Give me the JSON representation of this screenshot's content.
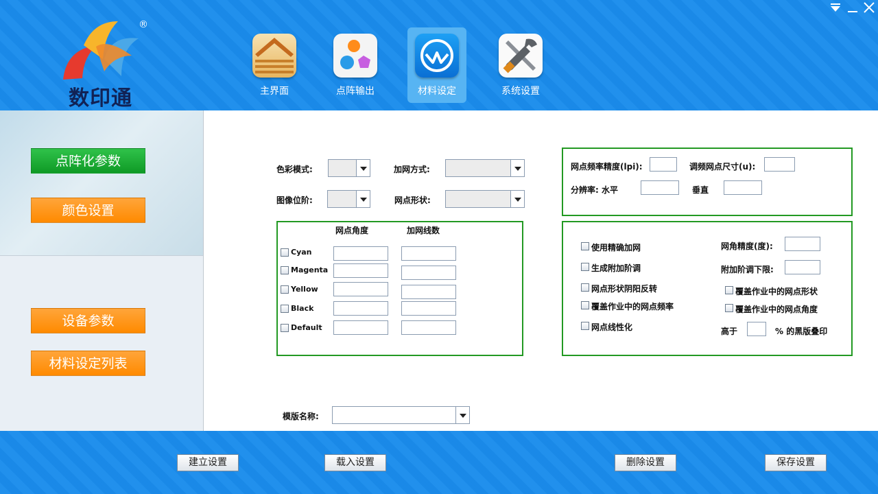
{
  "app": {
    "brand": "数印通",
    "reg_mark": "®"
  },
  "window_controls": {
    "menu": "⏷",
    "minimize": "—",
    "close": "✕"
  },
  "nav": [
    {
      "label": "主界面",
      "icon": "home-icon"
    },
    {
      "label": "点阵输出",
      "icon": "dots-output-icon"
    },
    {
      "label": "材料设定",
      "icon": "material-icon",
      "active": true
    },
    {
      "label": "系统设置",
      "icon": "tools-icon"
    }
  ],
  "sidebar": {
    "btn1": "点阵化参数",
    "btn2": "颜色设置",
    "btn3": "设备参数",
    "btn4": "材料设定列表"
  },
  "form": {
    "color_mode_label": "色彩模式:",
    "screening_method_label": "加网方式:",
    "image_bit_depth_label": "图像位阶:",
    "dot_shape_label": "网点形状:",
    "template_name_label": "模版名称:"
  },
  "screen_table": {
    "col_angle": "网点角度",
    "col_lines": "加网线数",
    "rows": [
      {
        "name": "Cyan"
      },
      {
        "name": "Magenta"
      },
      {
        "name": "Yellow"
      },
      {
        "name": "Black"
      },
      {
        "name": "Default"
      }
    ]
  },
  "resolution": {
    "lpi_precision_label": "网点频率精度(lpi):",
    "fm_dot_size_label": "调频网点尺寸(u):",
    "resolution_label": "分辨率: 水平",
    "vertical_label": "垂直"
  },
  "options": {
    "precise_screening": "使用精确加网",
    "generate_extra_steps": "生成附加阶调",
    "dot_shape_invert": "网点形状阴阳反转",
    "override_dot_freq": "覆盖作业中的网点频率",
    "dot_linearize": "网点线性化",
    "angle_precision_label": "网角精度(度):",
    "extra_step_lower_label": "附加阶调下限:",
    "override_dot_shape": "覆盖作业中的网点形状",
    "override_dot_angle": "覆盖作业中的网点角度",
    "above_label": "高于",
    "black_overprint_label": "% 的黑版叠印"
  },
  "footer": {
    "create": "建立设置",
    "load": "载入设置",
    "delete": "删除设置",
    "save": "保存设置"
  },
  "colors": {
    "header_blue": "#1a8cec",
    "group_border": "#229922",
    "btn_green": "#18a82e",
    "btn_orange": "#ff9a1a"
  }
}
